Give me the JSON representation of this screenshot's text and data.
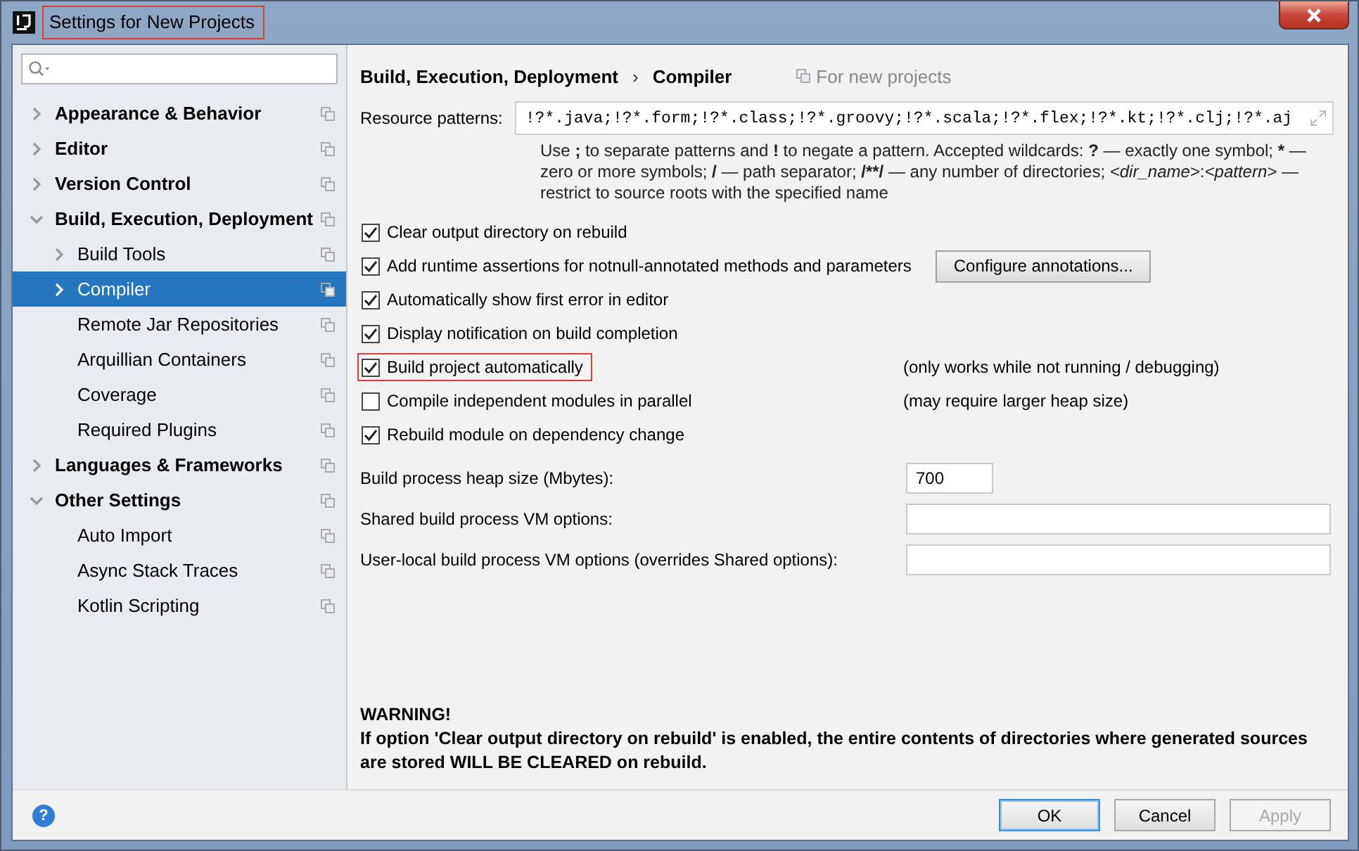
{
  "window": {
    "title": "Settings for New Projects",
    "title_highlighted": true
  },
  "sidebar": {
    "items": [
      {
        "label": "Appearance & Behavior",
        "kind": "folder",
        "expanded": false,
        "selected": false
      },
      {
        "label": "Editor",
        "kind": "folder",
        "expanded": false,
        "selected": false
      },
      {
        "label": "Version Control",
        "kind": "folder",
        "expanded": false,
        "selected": false
      },
      {
        "label": "Build, Execution, Deployment",
        "kind": "folder",
        "expanded": true,
        "selected": false,
        "children": [
          {
            "label": "Build Tools",
            "kind": "folder",
            "expanded": false,
            "selected": false
          },
          {
            "label": "Compiler",
            "kind": "folder",
            "expanded": false,
            "selected": true
          },
          {
            "label": "Remote Jar Repositories",
            "kind": "leaf",
            "selected": false
          },
          {
            "label": "Arquillian Containers",
            "kind": "leaf",
            "selected": false
          },
          {
            "label": "Coverage",
            "kind": "leaf",
            "selected": false
          },
          {
            "label": "Required Plugins",
            "kind": "leaf",
            "selected": false
          }
        ]
      },
      {
        "label": "Languages & Frameworks",
        "kind": "folder",
        "expanded": false,
        "selected": false
      },
      {
        "label": "Other Settings",
        "kind": "folder",
        "expanded": true,
        "selected": false,
        "children": [
          {
            "label": "Auto Import",
            "kind": "leaf",
            "selected": false
          },
          {
            "label": "Async Stack Traces",
            "kind": "leaf",
            "selected": false
          },
          {
            "label": "Kotlin Scripting",
            "kind": "leaf",
            "selected": false
          }
        ]
      }
    ]
  },
  "breadcrumb": [
    "Build, Execution, Deployment",
    "Compiler"
  ],
  "breadcrumb_separator": "›",
  "scope": "For new projects",
  "resource_patterns": {
    "label": "Resource patterns:",
    "value": "!?*.java;!?*.form;!?*.class;!?*.groovy;!?*.scala;!?*.flex;!?*.kt;!?*.clj;!?*.aj"
  },
  "hint": [
    {
      "text": "Use ",
      "kind": "text"
    },
    {
      "text": ";",
      "kind": "symbol"
    },
    {
      "text": " to separate patterns and ",
      "kind": "text"
    },
    {
      "text": "!",
      "kind": "symbol"
    },
    {
      "text": " to negate a pattern. Accepted wildcards: ",
      "kind": "text"
    },
    {
      "text": "?",
      "kind": "symbol"
    },
    {
      "text": " — exactly one symbol; ",
      "kind": "text"
    },
    {
      "text": "*",
      "kind": "symbol"
    },
    {
      "text": " — zero or more symbols; ",
      "kind": "text"
    },
    {
      "text": "/",
      "kind": "symbol"
    },
    {
      "text": " — path separator; ",
      "kind": "text"
    },
    {
      "text": "/**/",
      "kind": "symbol"
    },
    {
      "text": " — any number of directories; ",
      "kind": "text"
    },
    {
      "text": "<dir_name>",
      "kind": "placeholder"
    },
    {
      "text": ":",
      "kind": "text"
    },
    {
      "text": "<pattern>",
      "kind": "placeholder"
    },
    {
      "text": " — restrict to source roots with the specified name",
      "kind": "text"
    }
  ],
  "options": [
    {
      "label": "Clear output directory on rebuild",
      "checked": true,
      "highlighted": false
    },
    {
      "label": "Add runtime assertions for notnull-annotated methods and parameters",
      "checked": true,
      "highlighted": false,
      "button": "Configure annotations..."
    },
    {
      "label": "Automatically show first error in editor",
      "checked": true,
      "highlighted": false
    },
    {
      "label": "Display notification on build completion",
      "checked": true,
      "highlighted": false
    },
    {
      "label": "Build project automatically",
      "checked": true,
      "highlighted": true,
      "note": "(only works while not running / debugging)"
    },
    {
      "label": "Compile independent modules in parallel",
      "checked": false,
      "highlighted": false,
      "note": "(may require larger heap size)"
    },
    {
      "label": "Rebuild module on dependency change",
      "checked": true,
      "highlighted": false
    }
  ],
  "fields": [
    {
      "label": "Build process heap size (Mbytes):",
      "value": "700",
      "kind": "short"
    },
    {
      "label": "Shared build process VM options:",
      "kind": "wide"
    },
    {
      "label": "User-local build process VM options (overrides Shared options):",
      "kind": "wide"
    }
  ],
  "warning": {
    "title": "WARNING!",
    "text": "If option 'Clear output directory on rebuild' is enabled, the entire contents of directories where generated sources are stored WILL BE CLEARED on rebuild."
  },
  "help": "?",
  "buttons": [
    {
      "label": "OK",
      "kind": "default",
      "disabled": false
    },
    {
      "label": "Cancel",
      "kind": "normal",
      "disabled": false
    },
    {
      "label": "Apply",
      "kind": "normal",
      "disabled": true
    }
  ]
}
